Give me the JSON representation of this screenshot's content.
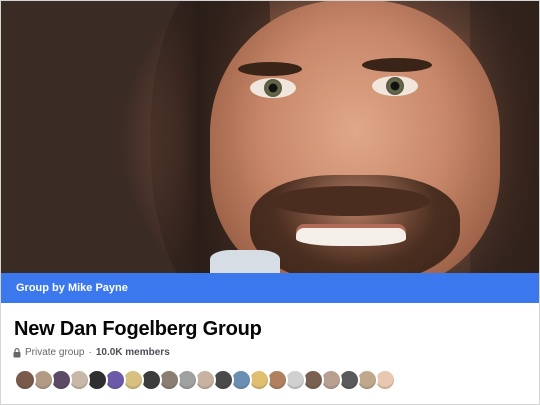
{
  "cover": {
    "icon": "cover-photo"
  },
  "banner": {
    "text": "Group by Mike Payne",
    "color": "#3b78ed"
  },
  "group": {
    "name": "New Dan Fogelberg Group",
    "privacy": "Private group",
    "separator": "·",
    "members": "10.0K members"
  },
  "member_avatars": [
    "#7a5b4a",
    "#b39a84",
    "#5d4a66",
    "#c8b8a8",
    "#2f2f2f",
    "#6b5aa8",
    "#d8c080",
    "#3c3c3c",
    "#8a7f72",
    "#a0a0a0",
    "#c9b3a0",
    "#4a4a4a",
    "#6b8fb3",
    "#e0c070",
    "#b08060",
    "#d0d0d0",
    "#7a6050",
    "#b8a090",
    "#5a5a5a",
    "#c0a88c",
    "#e8c8b0"
  ]
}
